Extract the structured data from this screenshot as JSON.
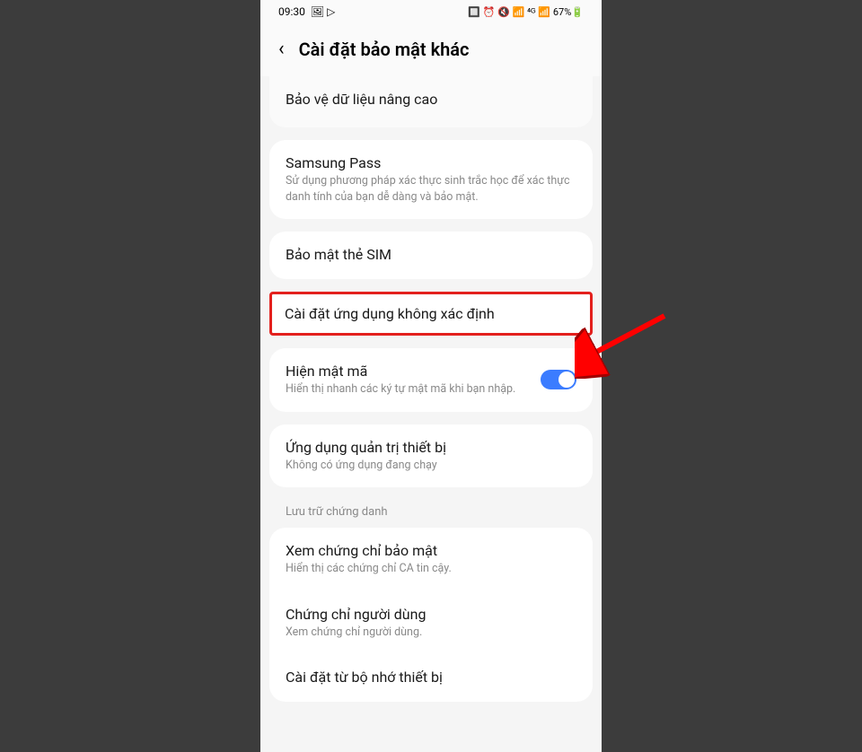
{
  "status": {
    "time": "09:30",
    "icons_left": "🖼 ▷",
    "icons_right": "🔲 ⏰ 🔇 📶 ⁴ᴳ 📶",
    "battery": "67%🔋"
  },
  "header": {
    "back_glyph": "‹",
    "title": "Cài đặt bảo mật khác"
  },
  "items": {
    "advanced_protection": "Bảo vệ dữ liệu nâng cao",
    "samsung_pass": {
      "title": "Samsung Pass",
      "sub": "Sử dụng phương pháp xác thực sinh trắc học để xác thực danh tính của bạn dễ dàng và bảo mật."
    },
    "sim_security": "Bảo mật thẻ SIM",
    "unknown_apps": "Cài đặt ứng dụng không xác định",
    "show_password": {
      "title": "Hiện mật mã",
      "sub": "Hiển thị nhanh các ký tự mật mã khi bạn nhập."
    },
    "device_admin": {
      "title": "Ứng dụng quản trị thiết bị",
      "sub": "Không có ứng dụng đang chạy"
    },
    "credential_section": "Lưu trữ chứng danh",
    "security_cert": {
      "title": "Xem chứng chỉ bảo mật",
      "sub": "Hiển thị các chứng chỉ CA tin cậy."
    },
    "user_cert": {
      "title": "Chứng chỉ người dùng",
      "sub": "Xem chứng chỉ người dùng."
    },
    "install_storage": "Cài đặt từ bộ nhớ thiết bị"
  }
}
